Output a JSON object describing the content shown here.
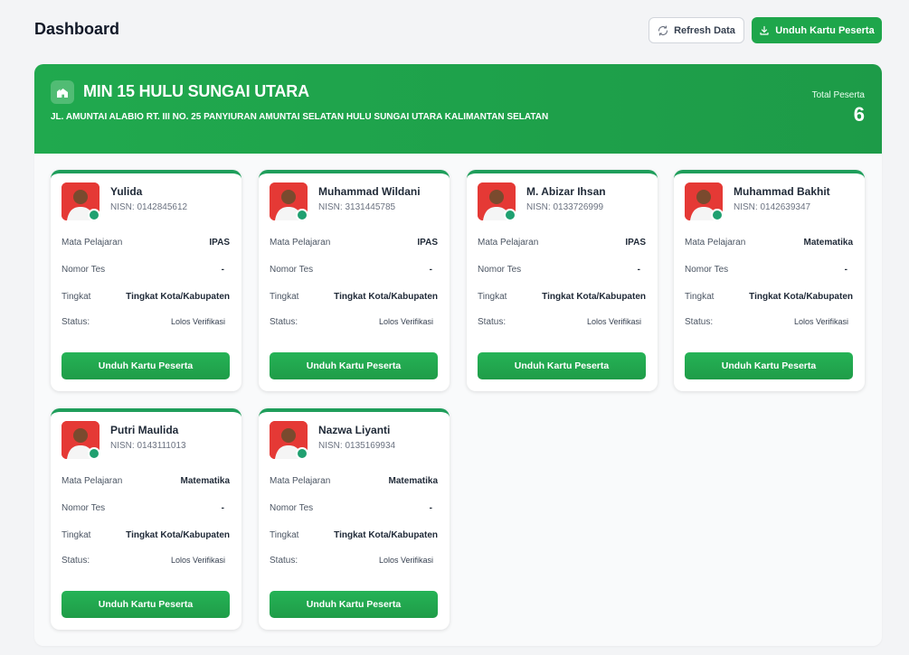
{
  "header": {
    "title": "Dashboard",
    "refresh_label": "Refresh Data",
    "download_label": "Unduh Kartu Peserta"
  },
  "school": {
    "name": "MIN 15 HULU SUNGAI UTARA",
    "address": "JL. AMUNTAI ALABIO RT. III NO. 25 PANYIURAN AMUNTAI SELATAN HULU SUNGAI UTARA KALIMANTAN SELATAN",
    "total_label": "Total Peserta",
    "total_value": "6"
  },
  "labels": {
    "subject": "Mata Pelajaran",
    "test_number": "Nomor Tes",
    "level": "Tingkat",
    "status": "Status:",
    "card_button": "Unduh Kartu Peserta"
  },
  "students": [
    {
      "name": "Yulida",
      "nisn": "NISN: 0142845612",
      "subject": "IPAS",
      "test_number": "-",
      "level": "Tingkat Kota/Kabupaten",
      "status": "Lolos Verifikasi"
    },
    {
      "name": "Muhammad Wildani",
      "nisn": "NISN: 3131445785",
      "subject": "IPAS",
      "test_number": "-",
      "level": "Tingkat Kota/Kabupaten",
      "status": "Lolos Verifikasi"
    },
    {
      "name": "M. Abizar Ihsan",
      "nisn": "NISN: 0133726999",
      "subject": "IPAS",
      "test_number": "-",
      "level": "Tingkat Kota/Kabupaten",
      "status": "Lolos Verifikasi"
    },
    {
      "name": "Muhammad Bakhit",
      "nisn": "NISN: 0142639347",
      "subject": "Matematika",
      "test_number": "-",
      "level": "Tingkat Kota/Kabupaten",
      "status": "Lolos Verifikasi"
    },
    {
      "name": "Putri Maulida",
      "nisn": "NISN: 0143111013",
      "subject": "Matematika",
      "test_number": "-",
      "level": "Tingkat Kota/Kabupaten",
      "status": "Lolos Verifikasi"
    },
    {
      "name": "Nazwa Liyanti",
      "nisn": "NISN: 0135169934",
      "subject": "Matematika",
      "test_number": "-",
      "level": "Tingkat Kota/Kabupaten",
      "status": "Lolos Verifikasi"
    }
  ],
  "icons": {
    "refresh": "refresh-icon",
    "download": "download-icon",
    "school": "school-icon"
  },
  "colors": {
    "primary": "#1ea64b",
    "accent_border": "#1f9e5b",
    "avatar_bg": "#e53935",
    "status_dot": "#20a070"
  }
}
